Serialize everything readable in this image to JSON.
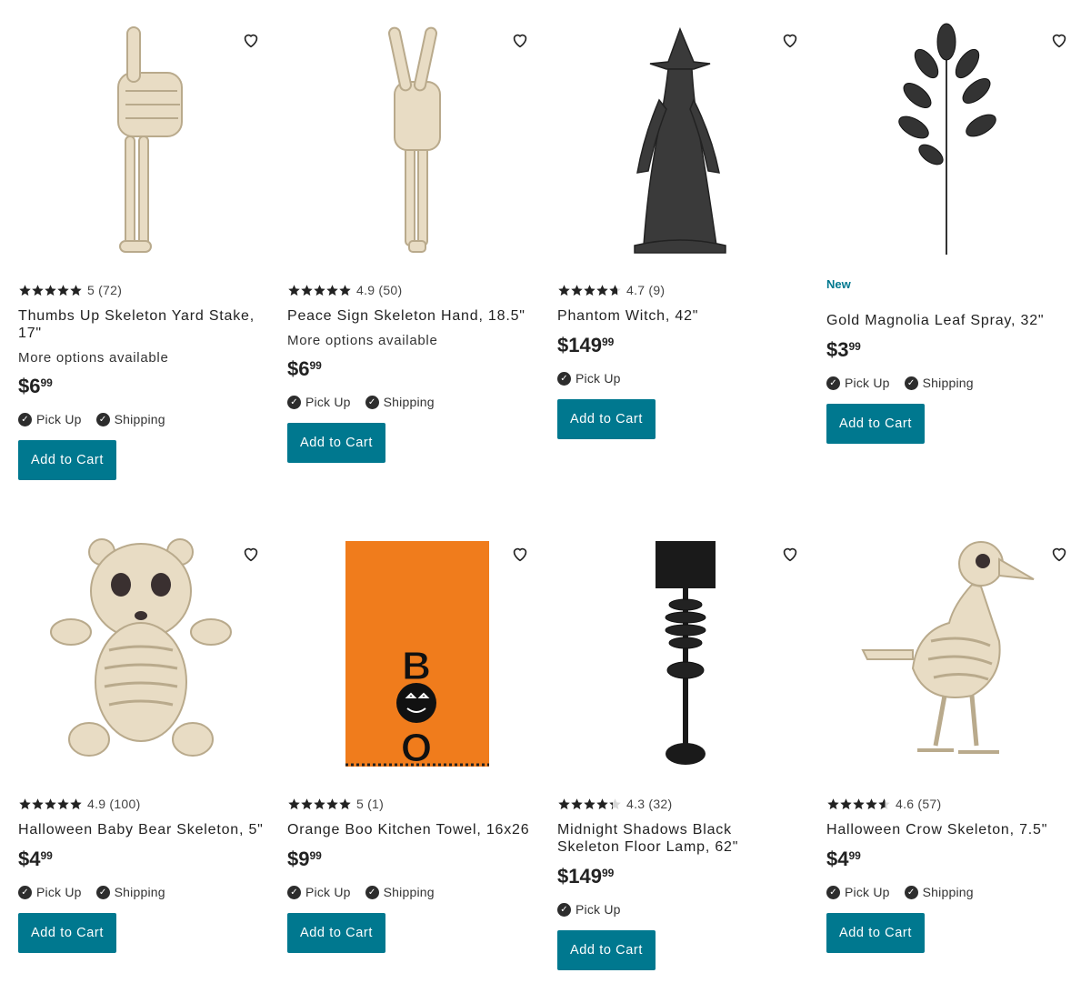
{
  "colors": {
    "accent": "#00788f",
    "star": "#222222",
    "check": "#2d2d2d"
  },
  "products": [
    {
      "name": "Thumbs Up Skeleton Yard Stake, 17\"",
      "rating": "5",
      "reviews": "(72)",
      "stars": 5,
      "more_options": "More options available",
      "price_dollars": "$6",
      "price_cents": "99",
      "availability": [
        "Pick Up",
        "Shipping"
      ],
      "cta": "Add to Cart",
      "favorite_icon": "heart-outline-icon"
    },
    {
      "name": "Peace Sign Skeleton Hand, 18.5\"",
      "rating": "4.9",
      "reviews": "(50)",
      "stars": 5,
      "more_options": "More options available",
      "price_dollars": "$6",
      "price_cents": "99",
      "availability": [
        "Pick Up",
        "Shipping"
      ],
      "cta": "Add to Cart",
      "favorite_icon": "heart-outline-icon"
    },
    {
      "name": "Phantom Witch, 42\"",
      "rating": "4.7",
      "reviews": "(9)",
      "stars": 4.7,
      "price_dollars": "$149",
      "price_cents": "99",
      "availability": [
        "Pick Up"
      ],
      "cta": "Add to Cart",
      "favorite_icon": "heart-outline-icon"
    },
    {
      "badge": "New",
      "name": "Gold Magnolia Leaf Spray, 32\"",
      "price_dollars": "$3",
      "price_cents": "99",
      "availability": [
        "Pick Up",
        "Shipping"
      ],
      "cta": "Add to Cart",
      "favorite_icon": "heart-outline-icon"
    },
    {
      "name": "Halloween Baby Bear Skeleton, 5\"",
      "rating": "4.9",
      "reviews": "(100)",
      "stars": 5,
      "price_dollars": "$4",
      "price_cents": "99",
      "availability": [
        "Pick Up",
        "Shipping"
      ],
      "cta": "Add to Cart",
      "favorite_icon": "heart-outline-icon"
    },
    {
      "name": "Orange Boo Kitchen Towel, 16x26",
      "rating": "5",
      "reviews": "(1)",
      "stars": 5,
      "price_dollars": "$9",
      "price_cents": "99",
      "availability": [
        "Pick Up",
        "Shipping"
      ],
      "cta": "Add to Cart",
      "favorite_icon": "heart-outline-icon"
    },
    {
      "name": "Midnight Shadows Black Skeleton Floor Lamp, 62\"",
      "rating": "4.3",
      "reviews": "(32)",
      "stars": 4.3,
      "price_dollars": "$149",
      "price_cents": "99",
      "availability": [
        "Pick Up"
      ],
      "cta": "Add to Cart",
      "favorite_icon": "heart-outline-icon"
    },
    {
      "name": "Halloween Crow Skeleton, 7.5\"",
      "rating": "4.6",
      "reviews": "(57)",
      "stars": 4.6,
      "price_dollars": "$4",
      "price_cents": "99",
      "availability": [
        "Pick Up",
        "Shipping"
      ],
      "cta": "Add to Cart",
      "favorite_icon": "heart-outline-icon"
    }
  ],
  "images": [
    "thumbs-up-skeleton-image",
    "peace-sign-skeleton-image",
    "phantom-witch-image",
    "magnolia-leaf-image",
    "baby-bear-skeleton-image",
    "boo-towel-image",
    "skeleton-floor-lamp-image",
    "crow-skeleton-image"
  ],
  "towel_letters": [
    "B",
    "O"
  ]
}
